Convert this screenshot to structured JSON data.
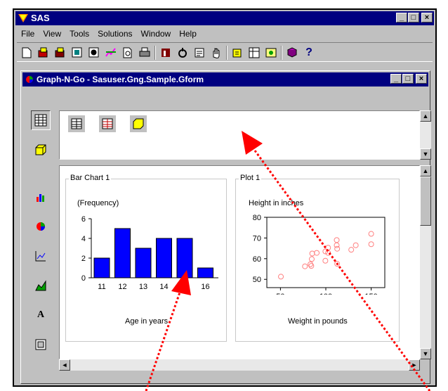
{
  "app": {
    "title": "SAS"
  },
  "menu": [
    "File",
    "View",
    "Tools",
    "Solutions",
    "Window",
    "Help"
  ],
  "toolbar_icons": [
    "new-icon",
    "open-icon",
    "save-icon",
    "preview-icon",
    "properties-icon",
    "graph-icon",
    "print-preview-icon",
    "print-icon",
    "build-icon",
    "refresh-icon",
    "notes-icon",
    "hand-icon",
    "help-assist-icon",
    "explorer-icon",
    "results-icon",
    "book-icon",
    "help-icon"
  ],
  "toolbar_help_glyph": "?",
  "child_window": {
    "title": "Graph-N-Go - Sasuser.Gng.Sample.Gform"
  },
  "left_tools": [
    "spreadsheet-tool-icon",
    "dataset-tool-icon",
    "bar-chart-tool-icon",
    "pie-chart-tool-icon",
    "line-chart-tool-icon",
    "area-chart-tool-icon",
    "text-tool-icon",
    "frame-tool-icon"
  ],
  "text_tool_label": "A",
  "bar_panel": {
    "title": "Bar Chart 1"
  },
  "plot_panel": {
    "title": "Plot 1"
  },
  "colors": {
    "title_bar": "#000080",
    "bars": "#0000ff",
    "markers": "#ff8080",
    "arrow": "#ff0000"
  },
  "chart_data": [
    {
      "type": "bar",
      "title": "",
      "ylabel": "(Frequency)",
      "xlabel": "Age in years",
      "categories": [
        "11",
        "12",
        "13",
        "14",
        "15",
        "16"
      ],
      "values": [
        2,
        5,
        3,
        4,
        4,
        1
      ],
      "ylim": [
        0,
        6
      ],
      "yticks": [
        "0",
        "2",
        "4",
        "6"
      ],
      "grid": false
    },
    {
      "type": "scatter",
      "title": "",
      "ylabel": "Height in inches",
      "xlabel": "Weight in pounds",
      "xlim": [
        35,
        165
      ],
      "ylim": [
        46,
        80
      ],
      "xticks": [
        "50",
        "100",
        "150"
      ],
      "yticks": [
        "50",
        "60",
        "70",
        "80"
      ],
      "grid": false,
      "x": [
        50.5,
        77,
        83,
        84,
        84.5,
        85,
        90,
        99.5,
        99.5,
        102.5,
        102.5,
        112,
        112,
        112.5,
        112.5,
        128,
        133,
        150,
        150
      ],
      "y": [
        51.3,
        56.3,
        57.3,
        56.5,
        59.8,
        62.5,
        62.8,
        63.5,
        59,
        62.8,
        65.3,
        66.5,
        69,
        64.8,
        57.5,
        64.3,
        66.5,
        72,
        67
      ]
    }
  ]
}
